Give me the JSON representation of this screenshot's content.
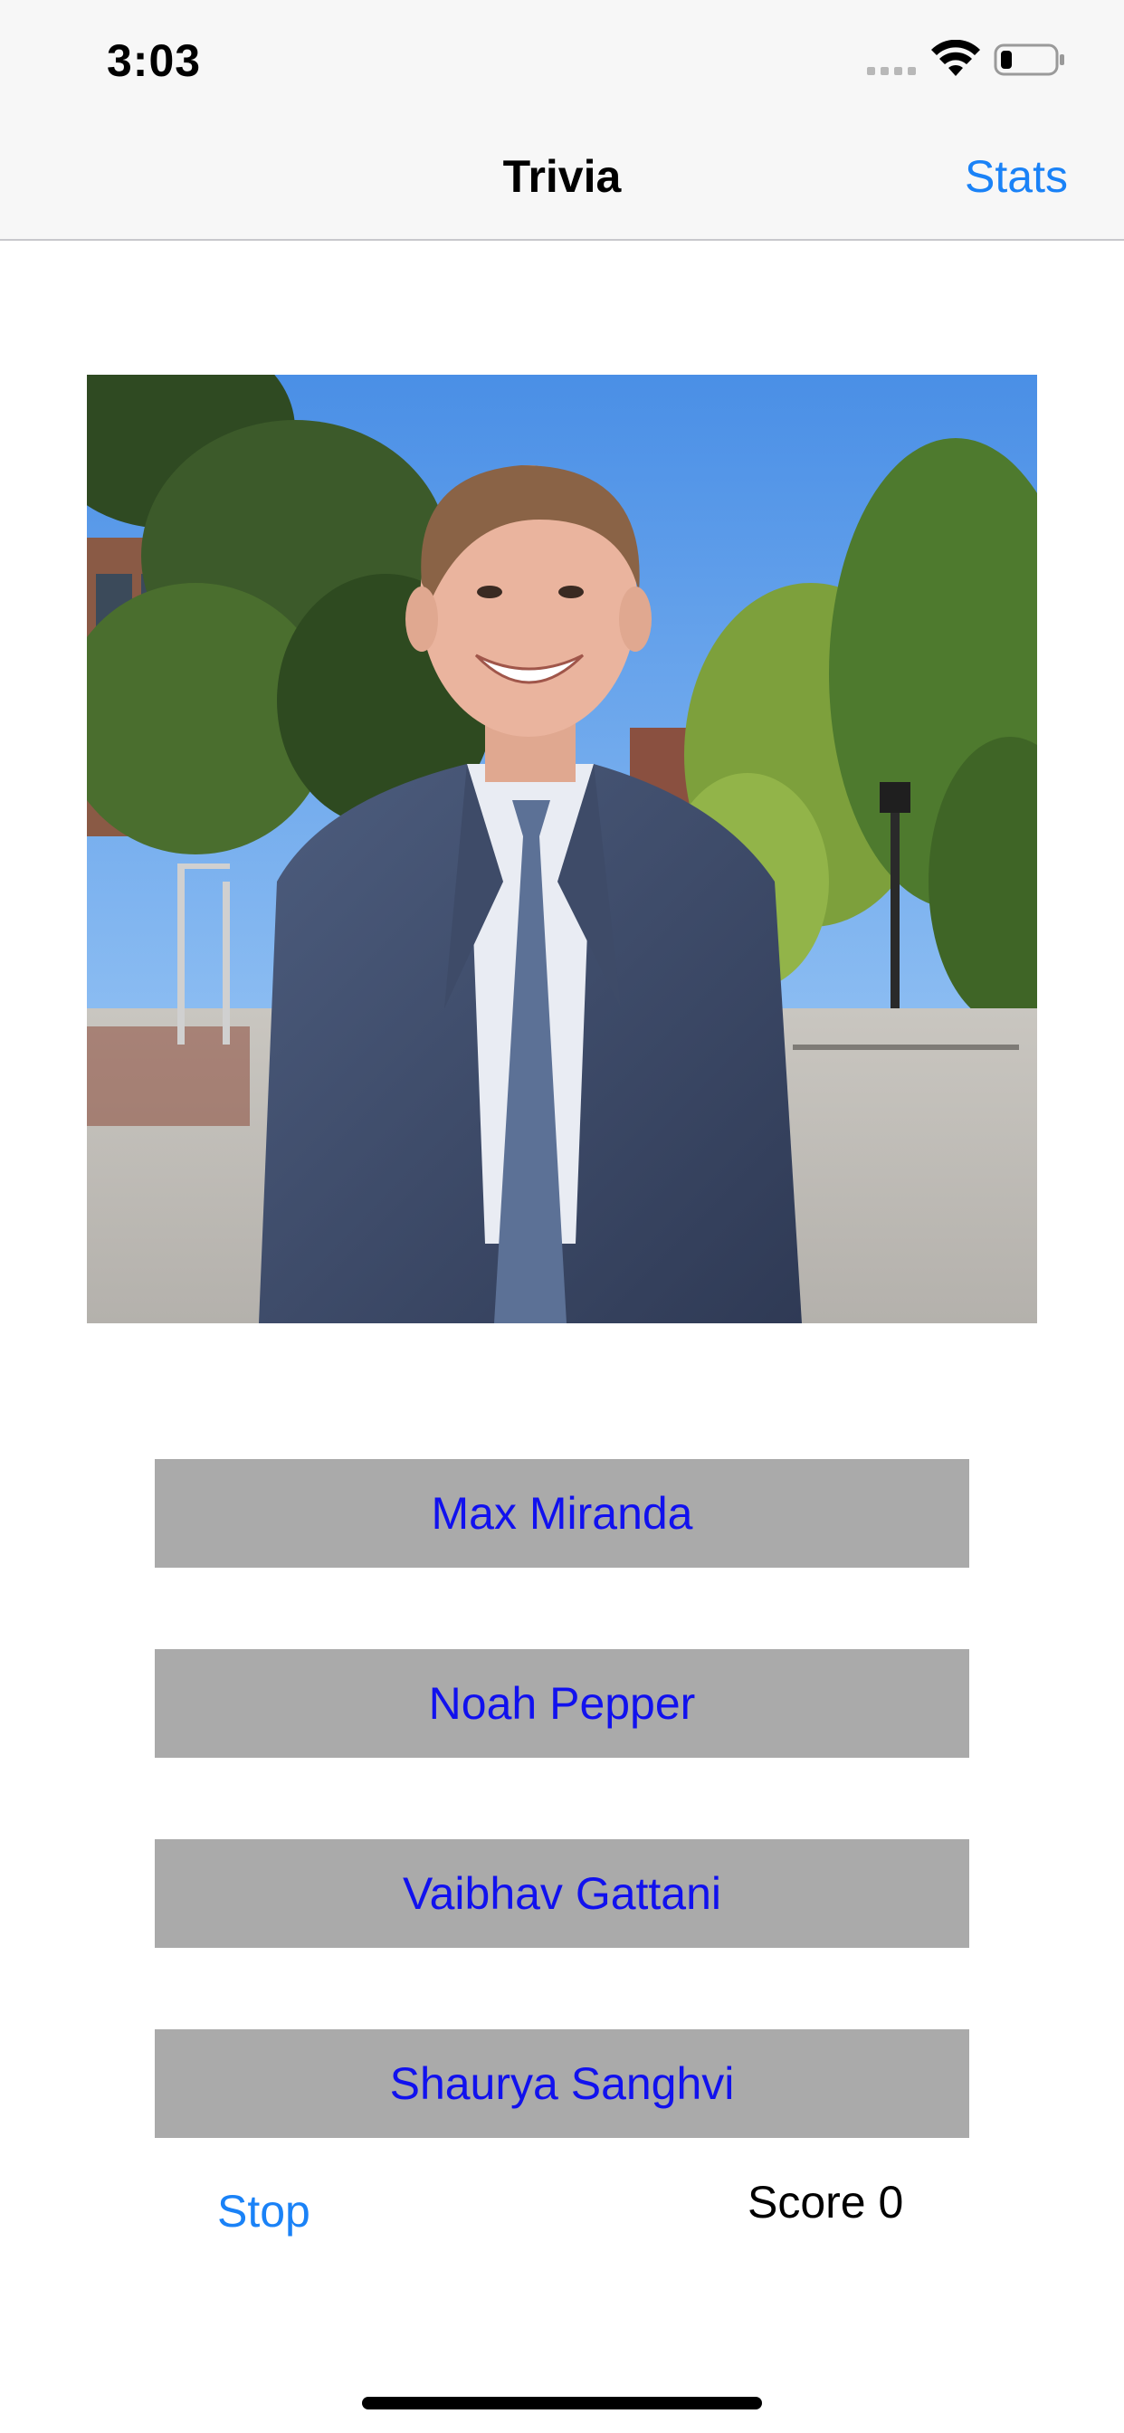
{
  "status_bar": {
    "time": "3:03",
    "icons": [
      "signal-icon",
      "wifi-icon",
      "battery-icon"
    ]
  },
  "nav": {
    "title": "Trivia",
    "stats_label": "Stats"
  },
  "question": {
    "photo_icon": "person-photo"
  },
  "answers": [
    {
      "label": "Max Miranda"
    },
    {
      "label": "Noah Pepper"
    },
    {
      "label": "Vaibhav Gattani"
    },
    {
      "label": "Shaurya Sanghvi"
    }
  ],
  "footer": {
    "stop_label": "Stop",
    "score_label": "Score 0"
  },
  "colors": {
    "accent": "#1a82f7",
    "button_bg": "#aaaaaa",
    "button_text": "#1111ee"
  }
}
